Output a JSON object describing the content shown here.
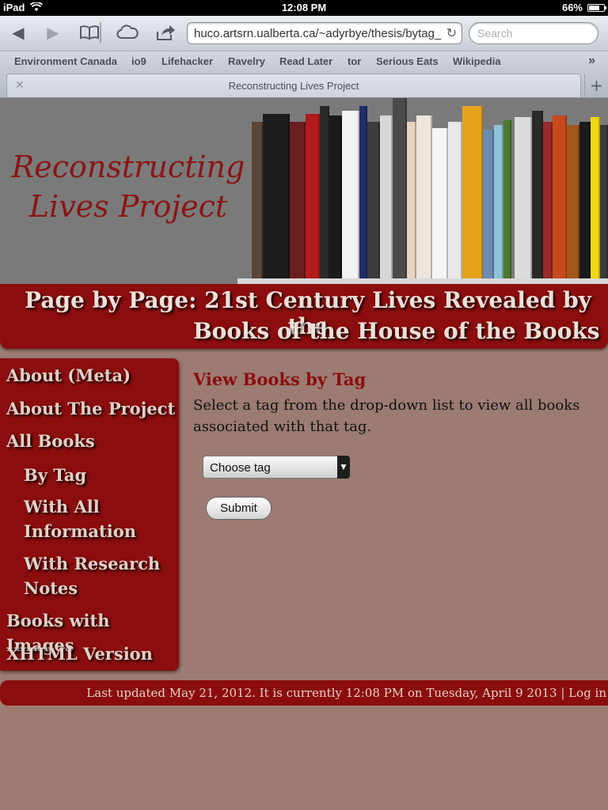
{
  "status": {
    "device": "iPad",
    "time": "12:08 PM",
    "battery": "66%"
  },
  "browser": {
    "url": "huco.artsrn.ualberta.ca/~adyrbye/thesis/bytag_",
    "search_placeholder": "Search",
    "bookmarks": [
      "Environment Canada",
      "io9",
      "Lifehacker",
      "Ravelry",
      "Read Later",
      "tor",
      "Serious Eats",
      "Wikipedia"
    ],
    "tab_title": "Reconstructing Lives Project"
  },
  "header": {
    "site_title_line1": "Reconstructing",
    "site_title_line2": "Lives Project",
    "heading_line1": "Page by Page: 21st Century Lives Revealed by the",
    "heading_line2": "Books of the House of the Books"
  },
  "nav": {
    "about_meta": "About (Meta)",
    "about_project": "About The Project",
    "all_books": "All Books",
    "by_tag": "By Tag",
    "with_all_1": "With All",
    "with_all_2": "Information",
    "with_research_1": "With Research",
    "with_research_2": "Notes",
    "books_images": "Books with Images",
    "xhtml": "XHTML Version"
  },
  "main": {
    "title": "View Books by Tag",
    "text_line1": "Select a tag from the drop-down list to view all books",
    "text_line2": "associated with that tag.",
    "select_value": "Choose tag",
    "submit_label": "Submit"
  },
  "footer": {
    "text": "Last updated May 21, 2012. It is currently 12:08 PM on Tuesday, April 9 2013 | Log in"
  },
  "colors": {
    "accent": "#8b0d0d",
    "background": "#9c7b72"
  }
}
